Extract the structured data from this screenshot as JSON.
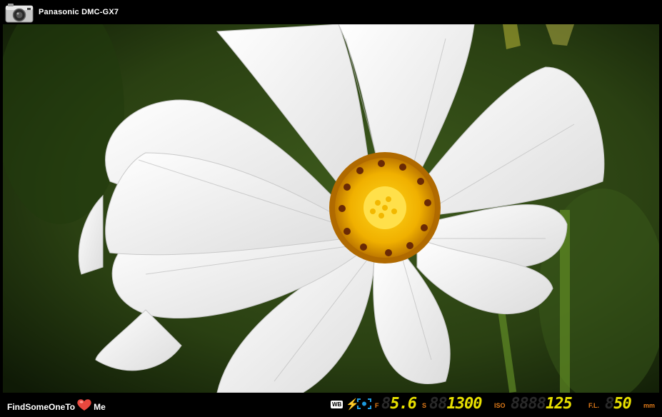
{
  "header": {
    "camera_model": "Panasonic DMC-GX7",
    "camera_icon": "camera-icon"
  },
  "photo": {
    "subject": "white-cosmos-flower-photo"
  },
  "footer": {
    "brand_before": "FindSomeOneTo",
    "brand_icon": "heart-icon",
    "brand_after": "Me",
    "wb_label": "WB",
    "aperture_label": "F",
    "aperture_value": "5.6",
    "shutter_label": "S",
    "shutter_value": "1300",
    "iso_label": "ISO",
    "iso_value": "125",
    "focal_label": "F.L.",
    "focal_value": "50",
    "focal_unit": "mm"
  },
  "colors": {
    "segment": "#e8e000",
    "label": "#e07a18",
    "heart": "#e8483e",
    "meter": "#1e9be0"
  }
}
